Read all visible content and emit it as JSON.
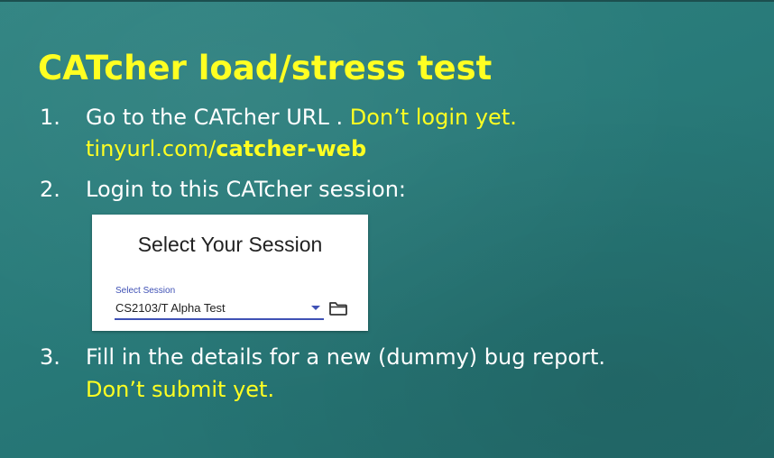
{
  "slide": {
    "title": "CATcher load/stress test",
    "steps": [
      {
        "number": "1.",
        "text": "Go to the CATcher URL . ",
        "highlight": "Don’t login yet.",
        "url_prefix": "tinyurl.com/",
        "url_bold": "catcher-web"
      },
      {
        "number": "2.",
        "text": "Login to this CATcher session:"
      },
      {
        "number": "3.",
        "text": "Fill in the details for a new (dummy) bug report.",
        "highlight": "Don’t submit yet."
      }
    ]
  },
  "session_card": {
    "title": "Select Your Session",
    "field_label": "Select Session",
    "selected_value": "CS2103/T Alpha Test",
    "icons": {
      "dropdown": "chevron-down-icon",
      "open": "folder-icon"
    }
  },
  "colors": {
    "background": "#2a7b79",
    "highlight_yellow": "#ffff22",
    "accent": "#3f51b5"
  }
}
